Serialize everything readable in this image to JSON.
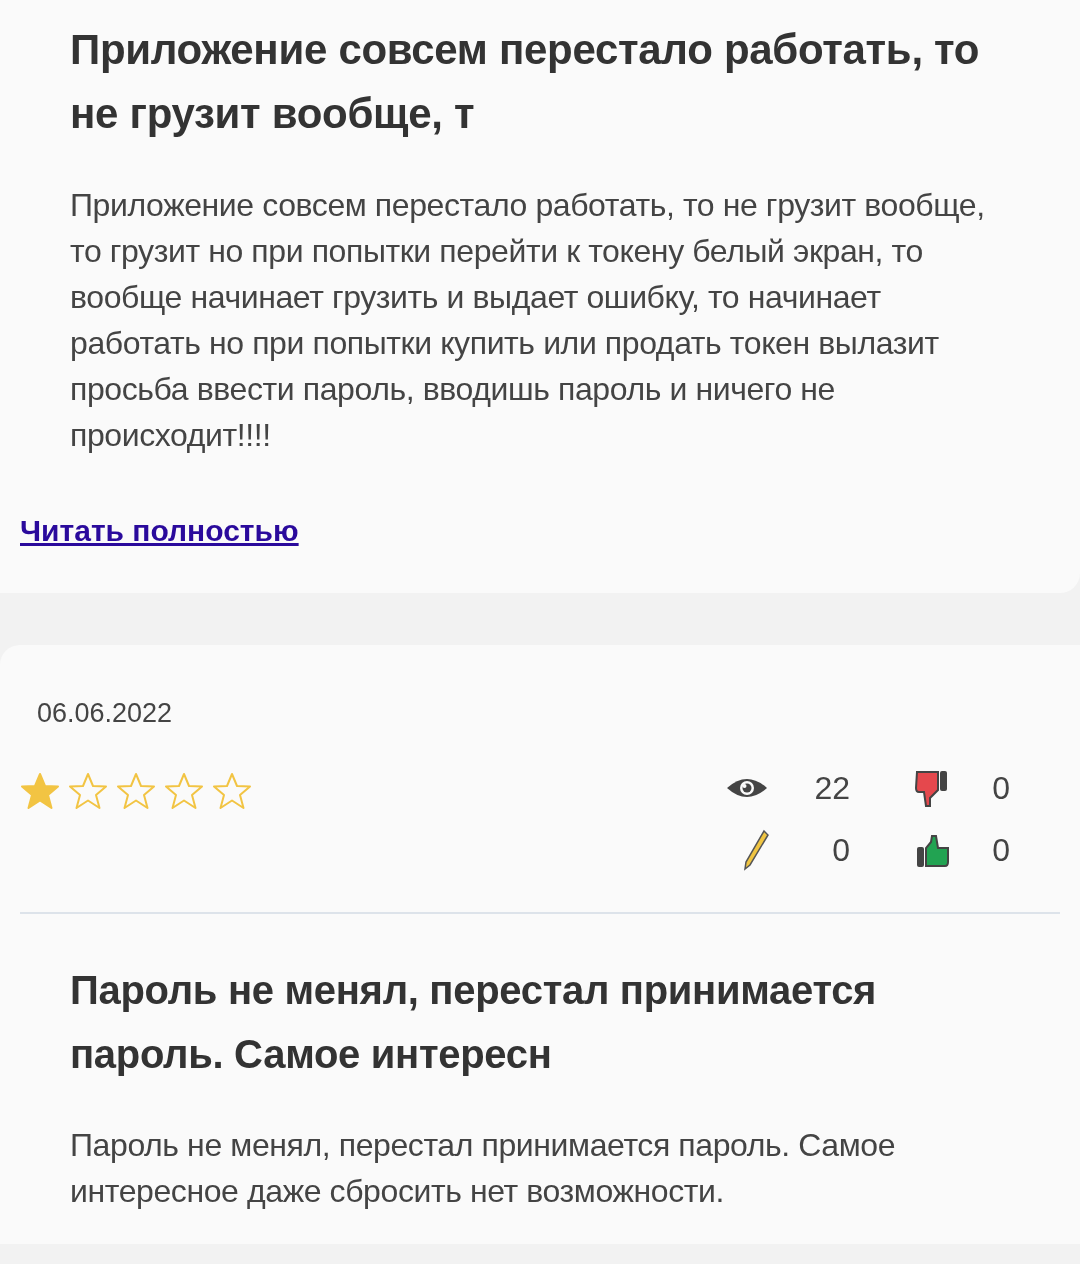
{
  "top_review": {
    "title": "Приложение совсем перестало работать, то не грузит вообще, т",
    "text": "Приложение совсем перестало работать, то не грузит вообще, то грузит но при попытки перейти к токену белый экран, то вообще начинает грузить и выдает ошибку, то начинает работать но при попытки купить или продать токен вылазит просьба ввести пароль, вводишь пароль и ничего не происходит!!!!",
    "read_more": "Читать полностью"
  },
  "next_review": {
    "date": "06.06.2022",
    "stars": 1,
    "views": "22",
    "dislikes": "0",
    "comments": "0",
    "likes": "0",
    "title": "Пароль не менял, перестал принимается пароль. Самое интересн",
    "text": "Пароль не менял, перестал принимается пароль. Самое интересное даже сбросить нет возможности."
  }
}
